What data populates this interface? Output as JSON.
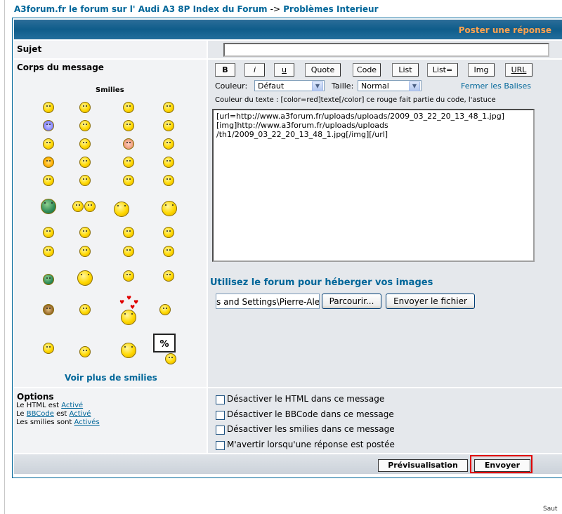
{
  "breadcrumb": {
    "site": "A3forum.fr le forum sur l' Audi A3 8P Index du Forum",
    "sep": "->",
    "section": "Problèmes Interieur"
  },
  "header": {
    "title": "Poster une réponse"
  },
  "subject": {
    "label": "Sujet",
    "value": ""
  },
  "body": {
    "label": "Corps du message",
    "text": "[url=http://www.a3forum.fr/uploads/uploads/2009_03_22_20_13_48_1.jpg]\n[img]http://www.a3forum.fr/uploads/uploads\n/th1/2009_03_22_20_13_48_1.jpg[/img][/url]"
  },
  "bbcode": {
    "buttons": [
      "B",
      "i",
      "u",
      "Quote",
      "Code",
      "List",
      "List=",
      "Img",
      "URL"
    ],
    "color_label": "Couleur:",
    "color_value": "Défaut",
    "size_label": "Taille:",
    "size_value": "Normal",
    "close_tags": "Fermer les Balises",
    "help": "Couleur du texte : [color=red]texte[/color] ce rouge fait partie du code, l'astuce"
  },
  "smilies": {
    "title": "Smilies",
    "more": "Voir plus de smilies"
  },
  "upload": {
    "title": "Utilisez le forum pour héberger vos images",
    "file_value": "s and Settings\\Pierre-Ale",
    "browse": "Parcourir...",
    "send": "Envoyer le fichier"
  },
  "options": {
    "title": "Options",
    "html_prefix": "Le HTML est ",
    "html_state": "Activé",
    "bb_prefix": "Le ",
    "bb_link": "BBCode",
    "bb_mid": " est ",
    "bb_state": "Activé",
    "sm_prefix": "Les smilies sont ",
    "sm_state": "Activés",
    "checkboxes": [
      "Désactiver le HTML dans ce message",
      "Désactiver le BBCode dans ce message",
      "Désactiver les smilies dans ce message",
      "M'avertir lorsqu'une réponse est postée"
    ]
  },
  "footer": {
    "preview": "Prévisualisation",
    "submit": "Envoyer"
  },
  "misc": {
    "saut": "Saut"
  }
}
